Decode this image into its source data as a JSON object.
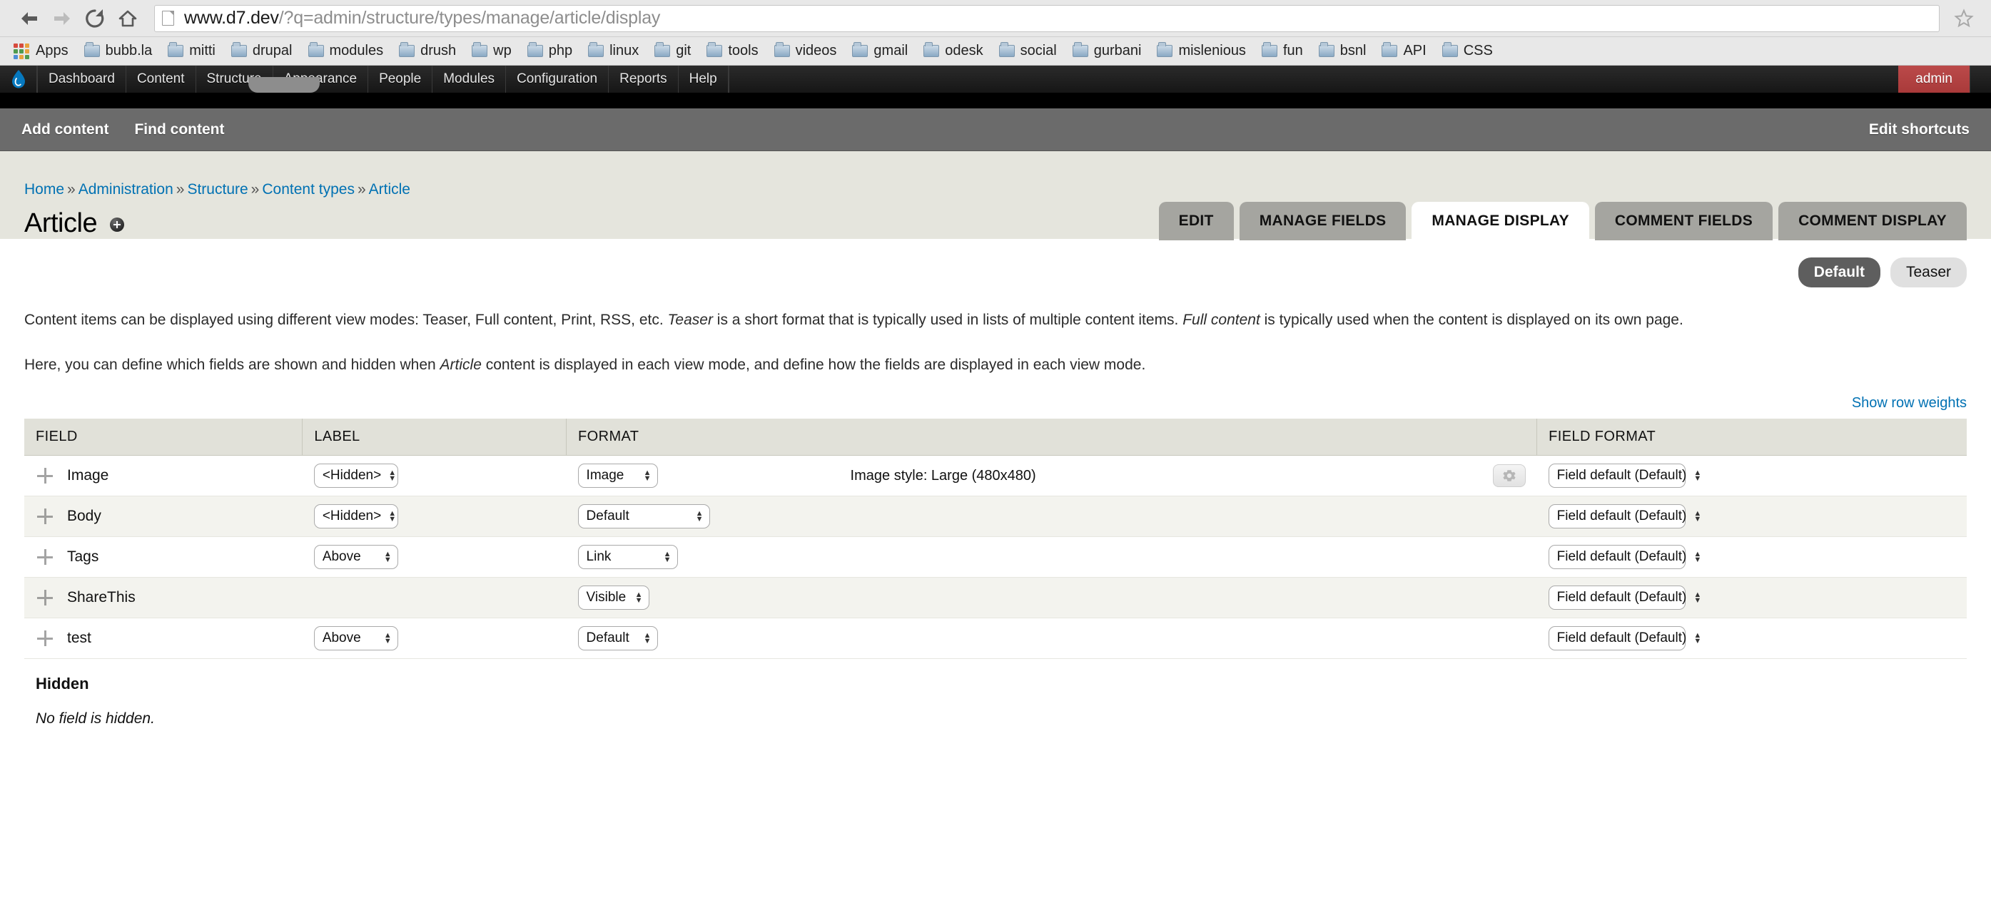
{
  "browser": {
    "back_icon": "back-arrow-icon",
    "forward_icon": "forward-arrow-icon",
    "reload_icon": "reload-icon",
    "home_icon": "home-icon",
    "url_host": "www.d7.dev",
    "url_path": "/?q=admin/structure/types/manage/article/display",
    "star_icon": "bookmark-star-icon",
    "bookmarks": [
      {
        "label": "Apps",
        "icon": "apps-grid-icon"
      },
      {
        "label": "bubb.la",
        "icon": "folder-icon"
      },
      {
        "label": "mitti",
        "icon": "folder-icon"
      },
      {
        "label": "drupal",
        "icon": "folder-icon"
      },
      {
        "label": "modules",
        "icon": "folder-icon"
      },
      {
        "label": "drush",
        "icon": "folder-icon"
      },
      {
        "label": "wp",
        "icon": "folder-icon"
      },
      {
        "label": "php",
        "icon": "folder-icon"
      },
      {
        "label": "linux",
        "icon": "folder-icon"
      },
      {
        "label": "git",
        "icon": "folder-icon"
      },
      {
        "label": "tools",
        "icon": "folder-icon"
      },
      {
        "label": "videos",
        "icon": "folder-icon"
      },
      {
        "label": "gmail",
        "icon": "folder-icon"
      },
      {
        "label": "odesk",
        "icon": "folder-icon"
      },
      {
        "label": "social",
        "icon": "folder-icon"
      },
      {
        "label": "gurbani",
        "icon": "folder-icon"
      },
      {
        "label": "mislenious",
        "icon": "folder-icon"
      },
      {
        "label": "fun",
        "icon": "folder-icon"
      },
      {
        "label": "bsnl",
        "icon": "folder-icon"
      },
      {
        "label": "API",
        "icon": "folder-icon"
      },
      {
        "label": "CSS",
        "icon": "folder-icon"
      }
    ]
  },
  "toolbar": {
    "logo_icon": "drupal-drop-icon",
    "items": [
      {
        "label": "Dashboard"
      },
      {
        "label": "Content"
      },
      {
        "label": "Structure"
      },
      {
        "label": "Appearance"
      },
      {
        "label": "People"
      },
      {
        "label": "Modules"
      },
      {
        "label": "Configuration"
      },
      {
        "label": "Reports"
      },
      {
        "label": "Help"
      }
    ],
    "user_label": "admin"
  },
  "shortcuts": {
    "add_content": "Add content",
    "find_content": "Find content",
    "edit_shortcuts": "Edit shortcuts"
  },
  "breadcrumb": {
    "items": [
      "Home",
      "Administration",
      "Structure",
      "Content types",
      "Article"
    ],
    "separator": "»"
  },
  "page": {
    "title": "Article",
    "add_icon": "plus-circle-icon"
  },
  "tabs": [
    {
      "label": "EDIT",
      "active": false
    },
    {
      "label": "MANAGE FIELDS",
      "active": false
    },
    {
      "label": "MANAGE DISPLAY",
      "active": true
    },
    {
      "label": "COMMENT FIELDS",
      "active": false
    },
    {
      "label": "COMMENT DISPLAY",
      "active": false
    }
  ],
  "view_modes": [
    {
      "label": "Default",
      "active": true
    },
    {
      "label": "Teaser",
      "active": false
    }
  ],
  "descriptions": {
    "p1_a": "Content items can be displayed using different view modes: Teaser, Full content, Print, RSS, etc. ",
    "p1_em1": "Teaser",
    "p1_b": " is a short format that is typically used in lists of multiple content items. ",
    "p1_em2": "Full content",
    "p1_c": " is typically used when the content is displayed on its own page.",
    "p2_a": "Here, you can define which fields are shown and hidden when ",
    "p2_em1": "Article",
    "p2_b": " content is displayed in each view mode, and define how the fields are displayed in each view mode."
  },
  "row_weights_link": "Show row weights",
  "table": {
    "headers": [
      "FIELD",
      "LABEL",
      "FORMAT",
      "FIELD FORMAT"
    ],
    "rows": [
      {
        "field": "Image",
        "label_select": "<Hidden>",
        "format_select": "Image",
        "summary": "Image style: Large (480x480)",
        "has_gear": true,
        "field_format_select": "Field default (Default)",
        "stripe": "odd"
      },
      {
        "field": "Body",
        "label_select": "<Hidden>",
        "format_select": "Default",
        "summary": "",
        "has_gear": false,
        "field_format_select": "Field default (Default)",
        "stripe": "even"
      },
      {
        "field": "Tags",
        "label_select": "Above",
        "format_select": "Link",
        "summary": "",
        "has_gear": false,
        "field_format_select": "Field default (Default)",
        "stripe": "odd"
      },
      {
        "field": "ShareThis",
        "label_select": "",
        "format_select": "Visible",
        "summary": "",
        "has_gear": false,
        "field_format_select": "Field default (Default)",
        "stripe": "even"
      },
      {
        "field": "test",
        "label_select": "Above",
        "format_select": "Default",
        "summary": "",
        "has_gear": false,
        "field_format_select": "Field default (Default)",
        "stripe": "odd"
      }
    ],
    "hidden_region_title": "Hidden",
    "hidden_region_note": "No field is hidden."
  },
  "colors": {
    "accent_link": "#0071b3",
    "admin_red": "#b34343",
    "toolbar_dark": "#1c1c1c",
    "shortcut_gray": "#6b6b6b",
    "page_head_bg": "#e5e5dd",
    "table_header_bg": "#e1e1d9"
  }
}
